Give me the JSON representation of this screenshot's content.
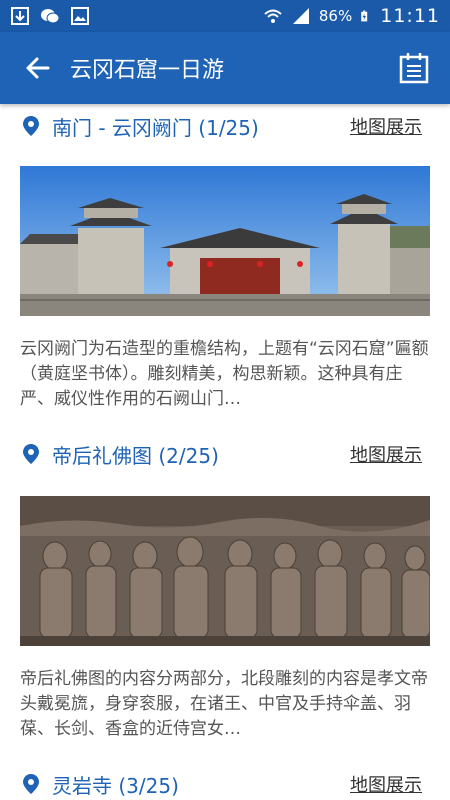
{
  "status": {
    "battery": "86%",
    "time": "11:11"
  },
  "app_bar": {
    "title": "云冈石窟一日游"
  },
  "items": [
    {
      "title": "南门 - 云冈阙门 (1/25)",
      "map_label": "地图展示",
      "description": "云冈阙门为石造型的重檐结构，上题有“云冈石窟”匾额（黄庭坚书体）。雕刻精美，构思新颖。这种具有庄严、威仪性作用的石阙山门…"
    },
    {
      "title": "帝后礼佛图 (2/25)",
      "map_label": "地图展示",
      "description": "帝后礼佛图的内容分两部分，北段雕刻的内容是孝文帝头戴冕旒，身穿衮服，在诸王、中官及手持伞盖、羽葆、长剑、香盒的近侍宫女…"
    },
    {
      "title": "灵岩寺 (3/25)",
      "map_label": "地图展示"
    }
  ],
  "icons": {
    "back": "arrow-left-icon",
    "calendar": "calendar-icon",
    "pin": "location-pin-icon"
  },
  "colors": {
    "primary": "#1e63b5",
    "status_bar": "#1a5aa8"
  }
}
